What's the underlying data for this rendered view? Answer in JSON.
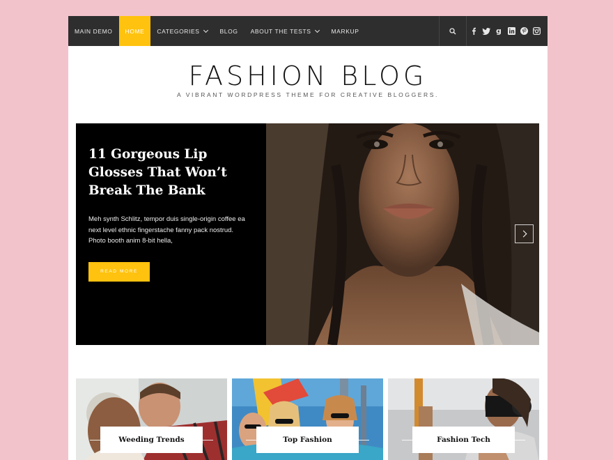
{
  "nav": {
    "items": [
      {
        "label": "MAIN DEMO",
        "active": false,
        "dropdown": false
      },
      {
        "label": "HOME",
        "active": true,
        "dropdown": false
      },
      {
        "label": "CATEGORIES",
        "active": false,
        "dropdown": true
      },
      {
        "label": "BLOG",
        "active": false,
        "dropdown": false
      },
      {
        "label": "ABOUT THE TESTS",
        "active": false,
        "dropdown": true
      },
      {
        "label": "MARKUP",
        "active": false,
        "dropdown": false
      }
    ],
    "search_icon": "search-icon",
    "social_icons": [
      "facebook-icon",
      "twitter-icon",
      "google-plus-icon",
      "linkedin-icon",
      "pinterest-icon",
      "instagram-icon"
    ]
  },
  "header": {
    "title": "FASHION BLOG",
    "tagline": "A VIBRANT WORDPRESS THEME FOR CREATIVE BLOGGERS."
  },
  "slider": {
    "title": "11 Gorgeous Lip Glosses That Won’t Break The Bank",
    "excerpt": "Meh synth Schlitz, tempor duis single-origin coffee ea next level ethnic fingerstache fanny pack nostrud. Photo booth anim 8-bit hella,",
    "button": "READ MORE"
  },
  "categories": [
    {
      "label": "Weeding Trends"
    },
    {
      "label": "Top Fashion"
    },
    {
      "label": "Fashion Tech"
    }
  ],
  "colors": {
    "accent": "#ffc20e",
    "nav_bg": "#2e2e2e",
    "page_bg": "#f3c3cb"
  }
}
